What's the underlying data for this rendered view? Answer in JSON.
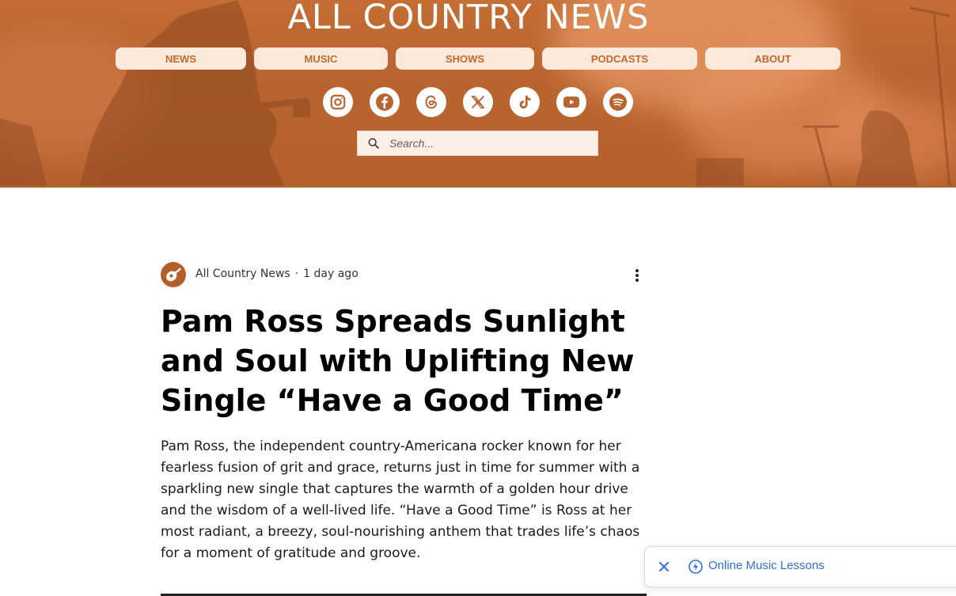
{
  "site": {
    "logo_text": "ALL COUNTRY NEWS"
  },
  "nav": {
    "items": [
      {
        "label": "NEWS"
      },
      {
        "label": "MUSIC"
      },
      {
        "label": "SHOWS"
      },
      {
        "label": "PODCASTS"
      },
      {
        "label": "ABOUT"
      }
    ]
  },
  "social": {
    "icons": [
      "instagram-icon",
      "facebook-icon",
      "threads-icon",
      "x-icon",
      "tiktok-icon",
      "youtube-icon",
      "spotify-icon"
    ]
  },
  "search": {
    "placeholder": "Search..."
  },
  "article": {
    "author": "All Country News",
    "separator": "·",
    "time_ago": "1 day ago",
    "title": "Pam Ross Spreads Sunlight and Soul with Uplifting New Single “Have a Good Time”",
    "body": "Pam Ross, the independent country-Americana rocker known for her fearless fusion of grit and grace, returns just in time for summer with a sparkling new single that captures the warmth of a golden hour drive and the wisdom of a well-lived life. “Have a Good Time” is Ross at her most radiant, a breezy, soul-nourishing anthem that trades life’s chaos for a moment of gratitude and groove."
  },
  "toast": {
    "label": "Online Music Lessons"
  },
  "colors": {
    "brand_orange": "#b96530",
    "nav_bg": "#fbe9dc",
    "nav_text": "#c2692d",
    "link_blue": "#2f6fdb"
  }
}
